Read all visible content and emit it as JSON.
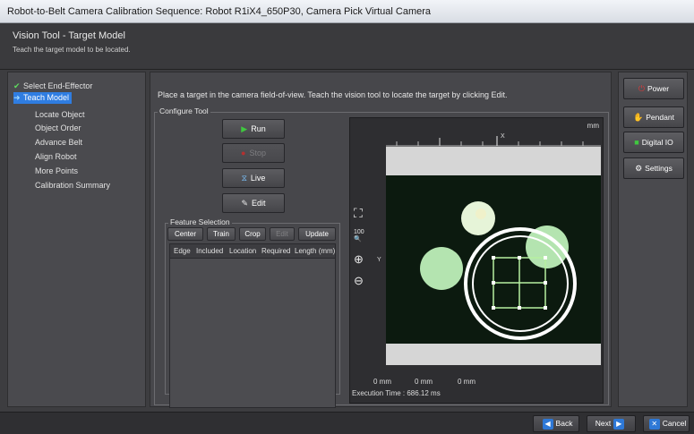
{
  "window": {
    "title": "Robot-to-Belt Camera Calibration Sequence: Robot R1iX4_650P30, Camera Pick Virtual Camera"
  },
  "header": {
    "title": "Vision Tool - Target Model",
    "subtitle": "Teach the target model to be located."
  },
  "nav": {
    "items": [
      {
        "label": "Select End-Effector",
        "state": "done"
      },
      {
        "label": "Teach Model",
        "state": "active"
      },
      {
        "label": "Locate Object",
        "state": "pending"
      },
      {
        "label": "Object Order",
        "state": "pending"
      },
      {
        "label": "Advance Belt",
        "state": "pending"
      },
      {
        "label": "Align Robot",
        "state": "pending"
      },
      {
        "label": "More Points",
        "state": "pending"
      },
      {
        "label": "Calibration Summary",
        "state": "pending"
      }
    ]
  },
  "main": {
    "instruction": "Place a target in the camera field-of-view.  Teach the vision tool to locate the target by clicking Edit.",
    "configure_label": "Configure Tool",
    "tool_buttons": {
      "run": "Run",
      "stop": "Stop",
      "live": "Live",
      "edit": "Edit"
    },
    "feature_selection": {
      "label": "Feature Selection",
      "buttons": {
        "center": "Center",
        "train": "Train",
        "crop": "Crop",
        "edit": "Edit",
        "update": "Update"
      },
      "columns": [
        "Edge",
        "Included",
        "Location",
        "Required",
        "Length (mm)"
      ]
    },
    "viewer": {
      "unit_label": "mm",
      "axis_x_label": "X",
      "axis_y_label": "Y",
      "zoom_100": "100",
      "mm_readouts": [
        "0 mm",
        "0 mm",
        "0 mm"
      ],
      "execution_time": "Execution Time : 686.12 ms"
    }
  },
  "right_panel": {
    "power": "Power",
    "pendant": "Pendant",
    "digital_io": "Digital IO",
    "settings": "Settings"
  },
  "footer": {
    "back": "Back",
    "next": "Next",
    "cancel": "Cancel"
  },
  "colors": {
    "accent": "#2f7de1",
    "check": "#5fdc5f",
    "power_icon": "#d93a3a",
    "stop_icon": "#d93a3a",
    "run_icon": "#3fc83f",
    "target_green": "#b8e6b8"
  }
}
